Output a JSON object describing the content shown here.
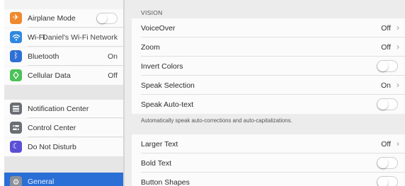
{
  "sidebar": {
    "items": [
      {
        "label": "Airplane Mode",
        "icon": "airplane-icon",
        "color": "#f0882e",
        "toggle": false
      },
      {
        "label": "Wi-Fi",
        "value": "Daniel's Wi-Fi Network",
        "icon": "wifi-icon",
        "color": "#2f88e0"
      },
      {
        "label": "Bluetooth",
        "value": "On",
        "icon": "bluetooth-icon",
        "color": "#2f6fd6"
      },
      {
        "label": "Cellular Data",
        "value": "Off",
        "icon": "cellular-icon",
        "color": "#4cc15a"
      },
      {
        "label": "Notification Center",
        "icon": "notification-center-icon",
        "color": "#6b6f75"
      },
      {
        "label": "Control Center",
        "icon": "control-center-icon",
        "color": "#6b6f75"
      },
      {
        "label": "Do Not Disturb",
        "icon": "moon-icon",
        "color": "#5b4fd6"
      },
      {
        "label": "General",
        "icon": "gear-icon",
        "color": "#8a8f98",
        "selected": true
      }
    ],
    "selected_color": "#2a6fd6"
  },
  "main": {
    "section_title": "VISION",
    "rows": [
      {
        "label": "VoiceOver",
        "value": "Off",
        "type": "disclosure"
      },
      {
        "label": "Zoom",
        "value": "Off",
        "type": "disclosure"
      },
      {
        "label": "Invert Colors",
        "type": "toggle",
        "on": false
      },
      {
        "label": "Speak Selection",
        "value": "On",
        "type": "disclosure"
      },
      {
        "label": "Speak Auto-text",
        "type": "toggle",
        "on": false
      }
    ],
    "footnote": "Automatically speak auto-corrections and auto-capitalizations.",
    "rows2": [
      {
        "label": "Larger Text",
        "value": "Off",
        "type": "disclosure"
      },
      {
        "label": "Bold Text",
        "type": "toggle",
        "on": false
      },
      {
        "label": "Button Shapes",
        "type": "toggle",
        "on": false
      }
    ],
    "chevron": "›"
  }
}
